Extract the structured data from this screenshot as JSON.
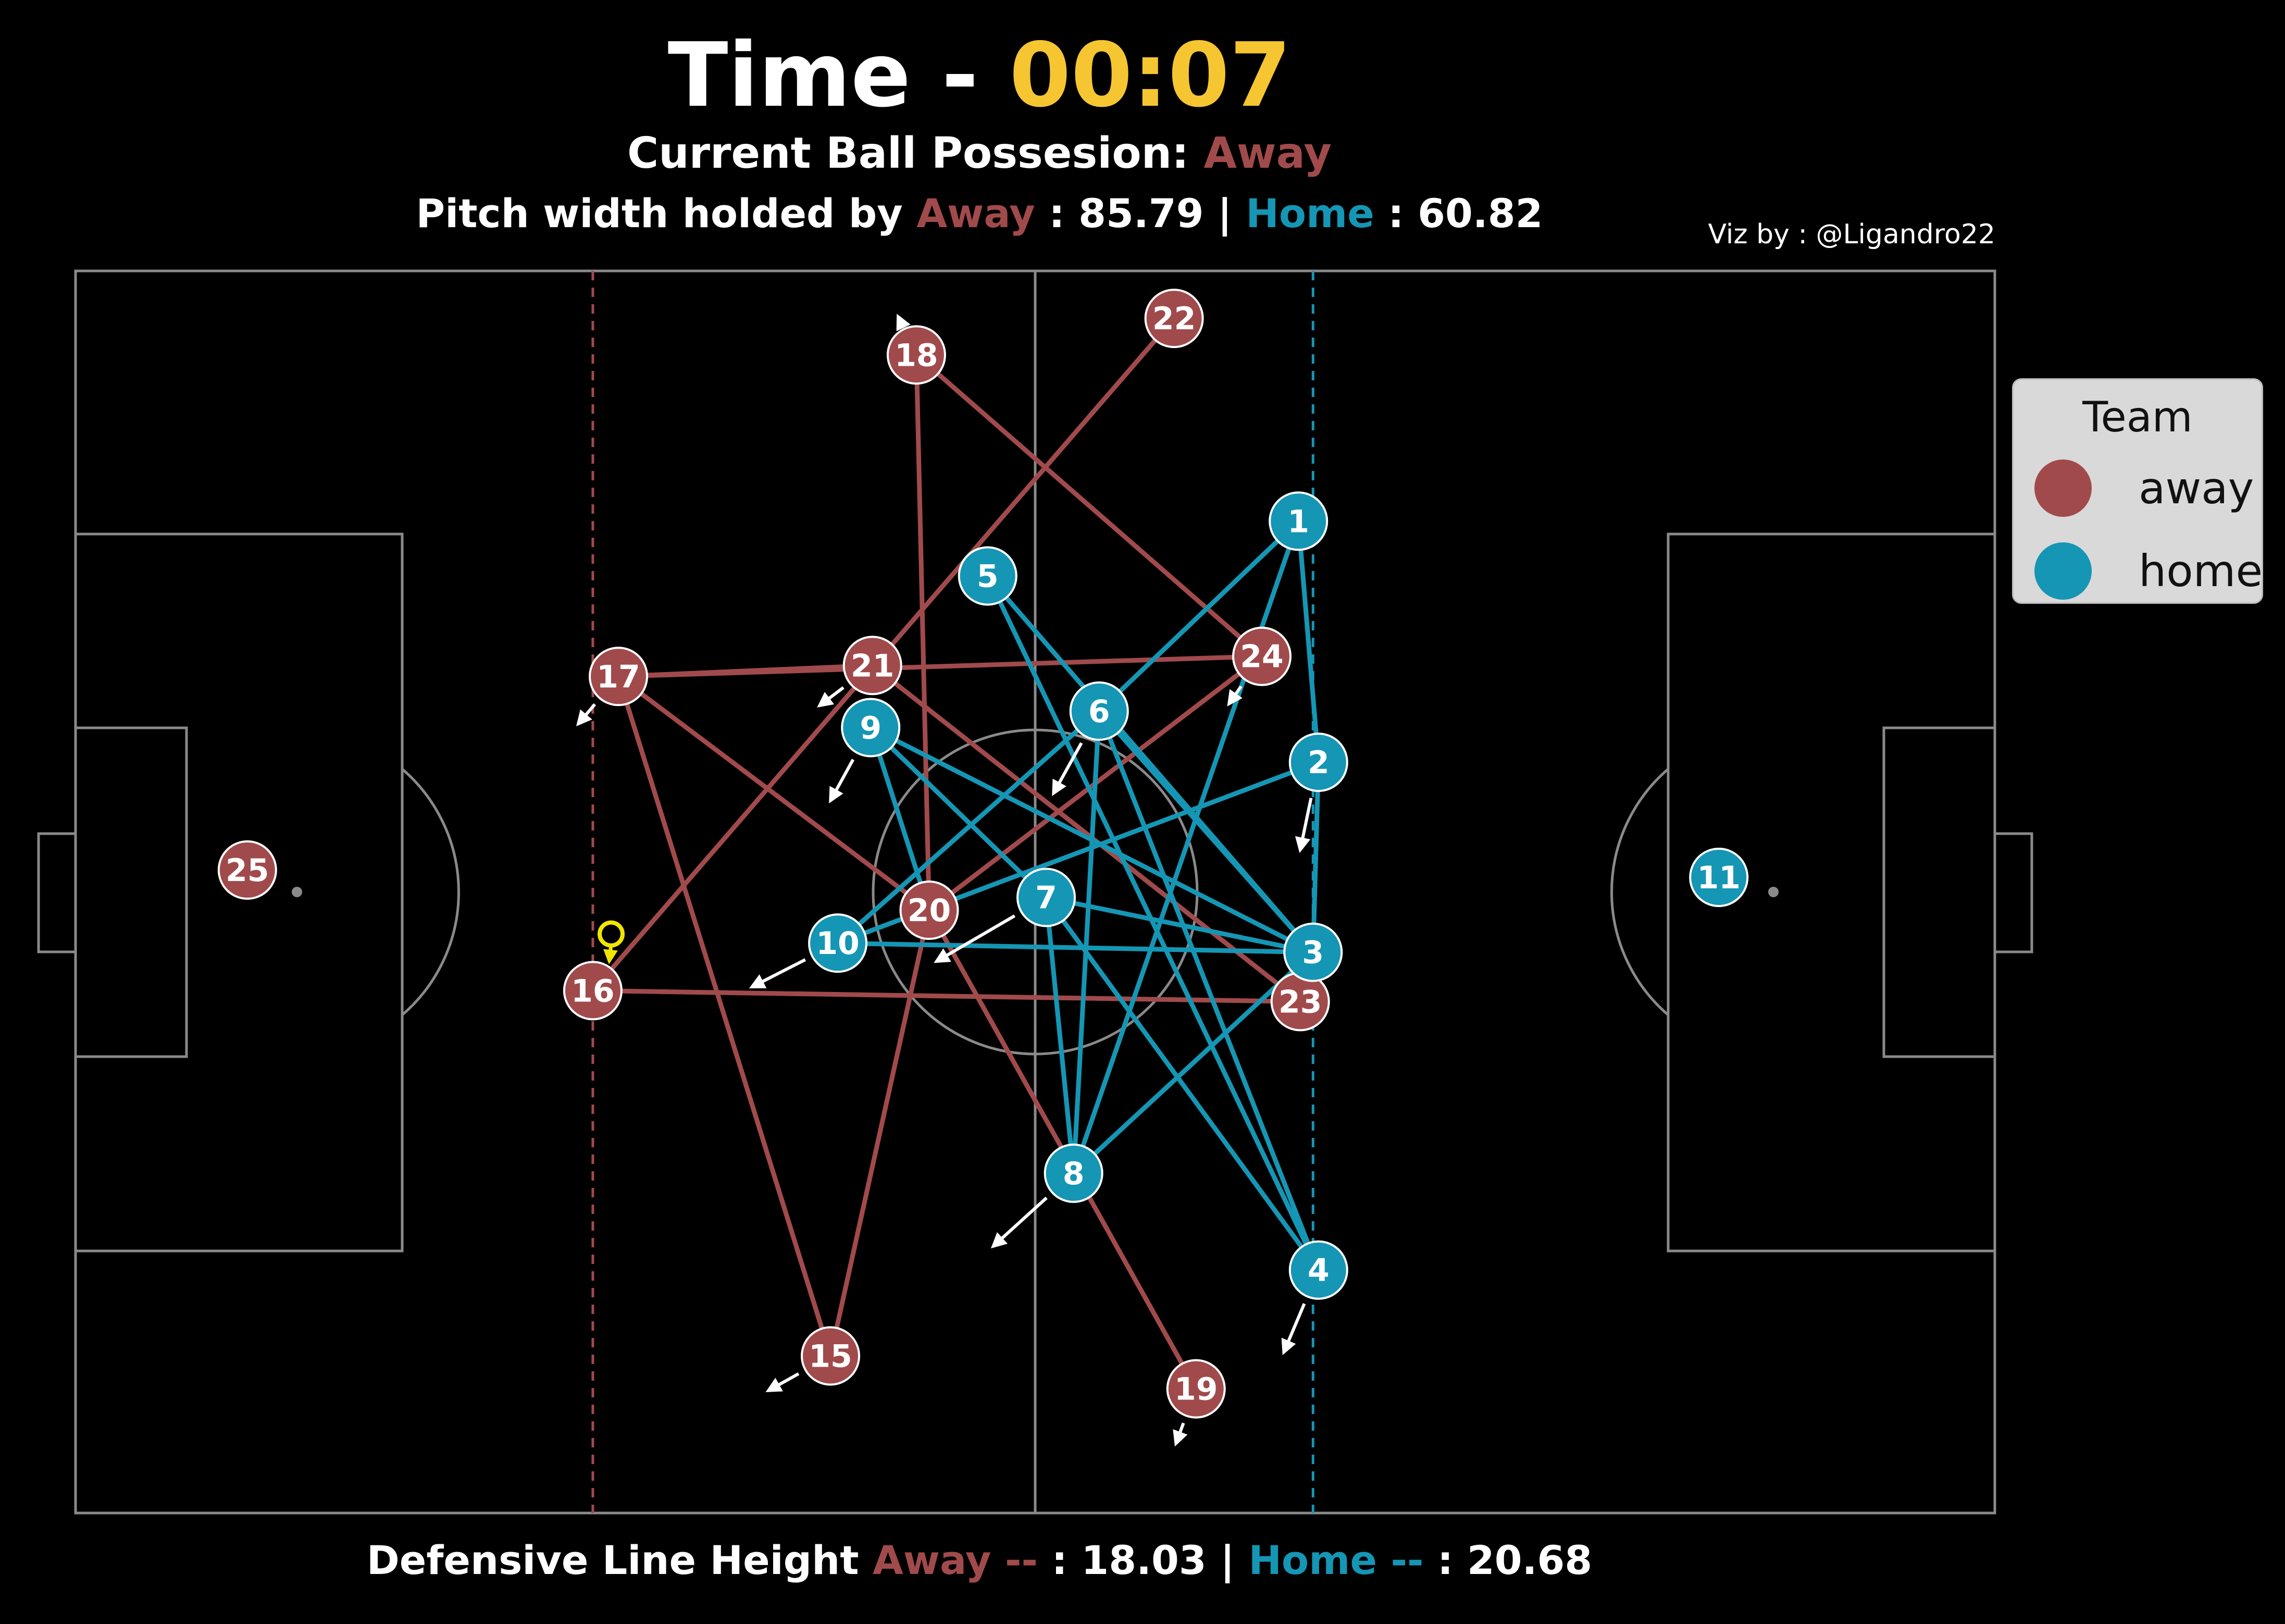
{
  "header": {
    "time_label": "Time - ",
    "time_value": "00:07",
    "possession_label": "Current Ball Possesion: ",
    "possession_team": "Away",
    "width_label": "Pitch width holded by ",
    "width_away_team": "Away",
    "width_away_value": " : 85.79",
    "width_sep": " | ",
    "width_home_team": "Home",
    "width_home_value": " : 60.82"
  },
  "credit": "Viz by : @Ligandro22",
  "footer": {
    "label": "Defensive Line Height ",
    "away_team": "Away --",
    "away_value": " : 18.03",
    "sep": " | ",
    "home_team": "Home -- ",
    "home_value": " : 20.68"
  },
  "legend": {
    "title": "Team",
    "items": [
      {
        "label": "away",
        "color": "#a14a4c"
      },
      {
        "label": "home",
        "color": "#1596b4"
      }
    ]
  },
  "colors": {
    "away": "#a14a4c",
    "home": "#1596b4",
    "time": "#f5c631",
    "ball": "#f2e600",
    "pitch_lines": "#8a8a8a",
    "background": "#000000"
  },
  "pitch": {
    "length": 105,
    "width": 68
  },
  "defensive_lines": {
    "away_x": 28.3,
    "home_x": 67.7
  },
  "ball": {
    "x": 29.3,
    "y": 31.7,
    "dx": -0.1,
    "dy": -1.5
  },
  "players": [
    {
      "number": "25",
      "team": "away",
      "x": 9.4,
      "y": 35.2,
      "dx": 0,
      "dy": 0
    },
    {
      "number": "18",
      "team": "away",
      "x": 46.0,
      "y": 63.4,
      "dx": -1.0,
      "dy": 2.1
    },
    {
      "number": "22",
      "team": "away",
      "x": 60.1,
      "y": 65.4,
      "dx": 0,
      "dy": 0
    },
    {
      "number": "17",
      "team": "away",
      "x": 29.7,
      "y": 45.8,
      "dx": -2.2,
      "dy": -2.6
    },
    {
      "number": "21",
      "team": "away",
      "x": 43.6,
      "y": 46.4,
      "dx": -2.9,
      "dy": -2.2
    },
    {
      "number": "24",
      "team": "away",
      "x": 64.9,
      "y": 46.9,
      "dx": -1.8,
      "dy": -2.6
    },
    {
      "number": "20",
      "team": "away",
      "x": 46.7,
      "y": 33.0,
      "dx": 0,
      "dy": 0
    },
    {
      "number": "16",
      "team": "away",
      "x": 28.3,
      "y": 28.6,
      "dx": 0,
      "dy": 0
    },
    {
      "number": "23",
      "team": "away",
      "x": 67.0,
      "y": 28.0,
      "dx": 0,
      "dy": 0
    },
    {
      "number": "15",
      "team": "away",
      "x": 41.3,
      "y": 8.6,
      "dx": -3.4,
      "dy": -1.9
    },
    {
      "number": "19",
      "team": "away",
      "x": 61.3,
      "y": 6.8,
      "dx": -1.1,
      "dy": -3.0
    },
    {
      "number": "11",
      "team": "home",
      "x": 89.9,
      "y": 34.8,
      "dx": 0,
      "dy": 0
    },
    {
      "number": "1",
      "team": "home",
      "x": 66.9,
      "y": 54.3,
      "dx": 0,
      "dy": 0
    },
    {
      "number": "5",
      "team": "home",
      "x": 49.9,
      "y": 51.3,
      "dx": 0,
      "dy": 0
    },
    {
      "number": "6",
      "team": "home",
      "x": 56.0,
      "y": 43.9,
      "dx": -2.5,
      "dy": -4.5
    },
    {
      "number": "9",
      "team": "home",
      "x": 43.5,
      "y": 43.0,
      "dx": -2.2,
      "dy": -4.0
    },
    {
      "number": "2",
      "team": "home",
      "x": 68.0,
      "y": 41.1,
      "dx": -1.0,
      "dy": -4.8
    },
    {
      "number": "7",
      "team": "home",
      "x": 53.1,
      "y": 33.7,
      "dx": -6.0,
      "dy": -3.5
    },
    {
      "number": "10",
      "team": "home",
      "x": 41.7,
      "y": 31.2,
      "dx": -4.7,
      "dy": -2.4
    },
    {
      "number": "3",
      "team": "home",
      "x": 67.7,
      "y": 30.7,
      "dx": 0,
      "dy": 0
    },
    {
      "number": "8",
      "team": "home",
      "x": 54.6,
      "y": 18.6,
      "dx": -4.4,
      "dy": -4.0
    },
    {
      "number": "4",
      "team": "home",
      "x": 68.0,
      "y": 13.3,
      "dx": -1.9,
      "dy": -4.5
    }
  ],
  "connections": {
    "away": [
      [
        "18",
        "20"
      ],
      [
        "18",
        "24"
      ],
      [
        "22",
        "16"
      ],
      [
        "17",
        "21"
      ],
      [
        "17",
        "24"
      ],
      [
        "17",
        "20"
      ],
      [
        "17",
        "15"
      ],
      [
        "21",
        "23"
      ],
      [
        "24",
        "20"
      ],
      [
        "20",
        "15"
      ],
      [
        "20",
        "19"
      ],
      [
        "16",
        "23"
      ]
    ],
    "home": [
      [
        "1",
        "6"
      ],
      [
        "1",
        "8"
      ],
      [
        "1",
        "2"
      ],
      [
        "5",
        "3"
      ],
      [
        "5",
        "4"
      ],
      [
        "6",
        "10"
      ],
      [
        "6",
        "8"
      ],
      [
        "6",
        "3"
      ],
      [
        "6",
        "4"
      ],
      [
        "9",
        "20"
      ],
      [
        "9",
        "7"
      ],
      [
        "9",
        "3"
      ],
      [
        "2",
        "10"
      ],
      [
        "2",
        "3"
      ],
      [
        "7",
        "8"
      ],
      [
        "7",
        "3"
      ],
      [
        "7",
        "4"
      ],
      [
        "10",
        "3"
      ],
      [
        "3",
        "8"
      ]
    ]
  }
}
